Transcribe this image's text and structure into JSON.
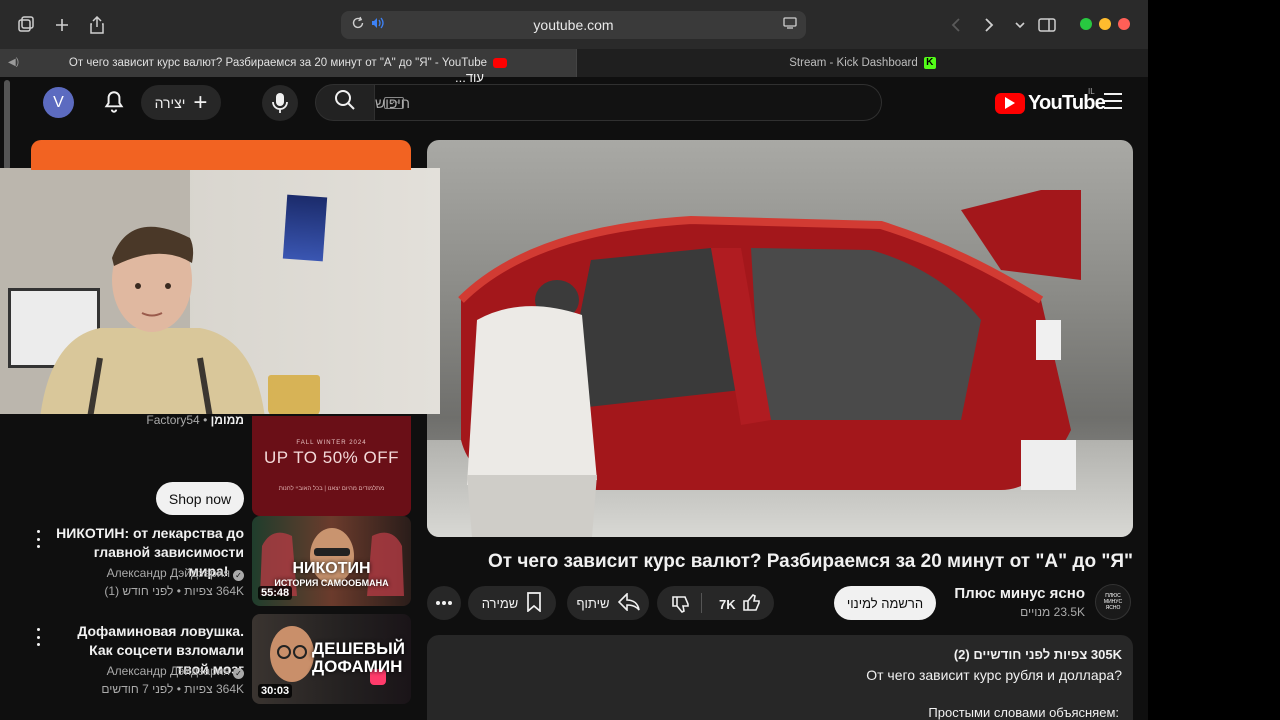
{
  "browser": {
    "url": "youtube.com",
    "tabs": [
      {
        "label": "От чего зависит курс валют? Разбираемся за 20 минут от \"А\" до \"Я\" - YouTube",
        "active": true
      },
      {
        "label": "Stream - Kick Dashboard",
        "active": false
      }
    ],
    "icons": {
      "sidebar": "sidebar-icon",
      "new_tab": "plus-icon",
      "share": "share-icon",
      "reload": "reload-icon",
      "audio": "audio-icon",
      "reader": "reader-icon",
      "back": "chevron-left-icon",
      "forward": "chevron-right-icon",
      "tab_overview": "chevron-down-icon",
      "split": "split-view-icon"
    },
    "traffic_lights": {
      "green": "#28c840",
      "yellow": "#febc2e",
      "red": "#ff5f57"
    }
  },
  "masthead": {
    "avatar_letter": "V",
    "create_label": "יצירה",
    "search_placeholder": "חיפוש",
    "logo_text": "YouTube",
    "logo_country": "IL"
  },
  "ad": {
    "advertiser": "Factory54",
    "sponsored": "ממומן",
    "thumb_small": "FALL WINTER 2024",
    "thumb_big": "UP TO 50% OFF",
    "thumb_tiny": "מתלמודים מהיום יצאנו | בכל האוביי לחנות",
    "cta": "Shop now",
    "accent": "#f26322"
  },
  "suggestions": [
    {
      "title": "НИКОТИН: от лекарства до главной зависимости мира! ...",
      "channel": "Александр Дэйдзария",
      "meta": "364K צפיות • לפני חודש (1)",
      "duration": "55:48",
      "thumb_text": "НИКОТИН",
      "thumb_sub": "ИСТОРИЯ САМООБМАНА"
    },
    {
      "title": "Дофаминовая ловушка. Как соцсети взломали твой мозг",
      "channel": "Александр Дэйдзария",
      "meta": "364K צפיות • לפני 7 חודשים",
      "duration": "30:03",
      "thumb_text": "ДЕШЕВЫЙ ДОФАМИН"
    }
  ],
  "video": {
    "title": "От чего зависит курс валют? Разбираемся за 20 минут от \"А\" до \"Я\"",
    "channel": "Плюс минус ясно",
    "channel_logo_text": "ПЛЮС МИНУС ЯСНО",
    "subscribers": "23.5K מנויים",
    "subscribe_label": "הרשמה למינוי",
    "likes": "7K",
    "share_label": "שיתוף",
    "save_label": "שמירה",
    "description": {
      "stats": "305K צפיות  לפני חודשיים (2)",
      "line1": "От чего зависит курс рубля и доллара?",
      "line2": "Простыми словами объясняем:",
      "more": "...עוד"
    }
  }
}
